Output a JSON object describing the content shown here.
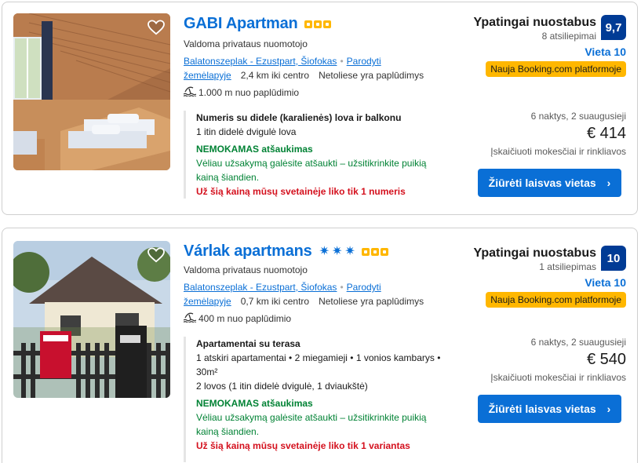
{
  "listings": [
    {
      "title": "GABI Apartman",
      "star_type": "squares",
      "stars": 3,
      "subtitle": "Valdoma privataus nuomotojo",
      "location_link": "Balatonszeplak - Ezustpart, Šiofokas",
      "map_link_1": "Parodyti",
      "map_link_2": "žemėlapyje",
      "distance": "2,4 km iki centro",
      "beach_nearby": "Netoliese yra paplūdimys",
      "beach_distance": "1.000 m nuo paplūdimio",
      "room_name": "Numeris su didele (karalienės) lova ir balkonu",
      "room_details": [
        "1 itin didelė dvigulė lova"
      ],
      "free_cancel": "NEMOKAMAS atšaukimas",
      "cancel_note_1": "Vėliau užsakymą galėsite atšaukti – užsitikrinkite puikią",
      "cancel_note_2": "kainą šiandien.",
      "scarcity": "Už šią kainą mūsų svetainėje liko tik 1 numeris",
      "rating_label": "Ypatingai nuostabus",
      "review_count": "8 atsiliepimai",
      "score": "9,7",
      "location_score": "Vieta 10",
      "badge": "Nauja Booking.com platformoje",
      "stay": "6 naktys, 2 suaugusieji",
      "price": "€ 414",
      "taxes": "Įskaičiuoti mokesčiai ir rinkliavos",
      "button": "Žiūrėti laisvas vietas"
    },
    {
      "title": "Várlak apartmans",
      "star_type": "squares",
      "stars": 3,
      "extra_symbols": [
        "✷",
        "✷",
        "✷"
      ],
      "subtitle": "Valdoma privataus nuomotojo",
      "location_link": "Balatonszeplak - Ezustpart, Šiofokas",
      "map_link_1": "Parodyti",
      "map_link_2": "žemėlapyje",
      "distance": "0,7 km iki centro",
      "beach_nearby": "Netoliese yra paplūdimys",
      "beach_distance": "400 m nuo paplūdimio",
      "room_name": "Apartamentai su terasa",
      "room_details": [
        "1 atskiri apartamentai • 2 miegamieji • 1 vonios kambarys •",
        "30m²",
        "2 lovos (1 itin didelė dvigulė, 1 dviaukštė)"
      ],
      "free_cancel": "NEMOKAMAS atšaukimas",
      "cancel_note_1": "Vėliau užsakymą galėsite atšaukti – užsitikrinkite puikią",
      "cancel_note_2": "kainą šiandien.",
      "scarcity": "Už šią kainą mūsų svetainėje liko tik 1 variantas",
      "rating_label": "Ypatingai nuostabus",
      "review_count": "1 atsiliepimas",
      "score": "10",
      "location_score": "Vieta 10",
      "badge": "Nauja Booking.com platformoje",
      "stay": "6 naktys, 2 suaugusieji",
      "price": "€ 540",
      "taxes": "Įskaičiuoti mokesčiai ir rinkliavos",
      "button": "Žiūrėti laisvas vietas"
    }
  ],
  "colors": {
    "link_blue": "#0a6fd6",
    "score_navy": "#003b95",
    "badge_yellow": "#ffb700",
    "green": "#008234",
    "red": "#d4111e"
  }
}
